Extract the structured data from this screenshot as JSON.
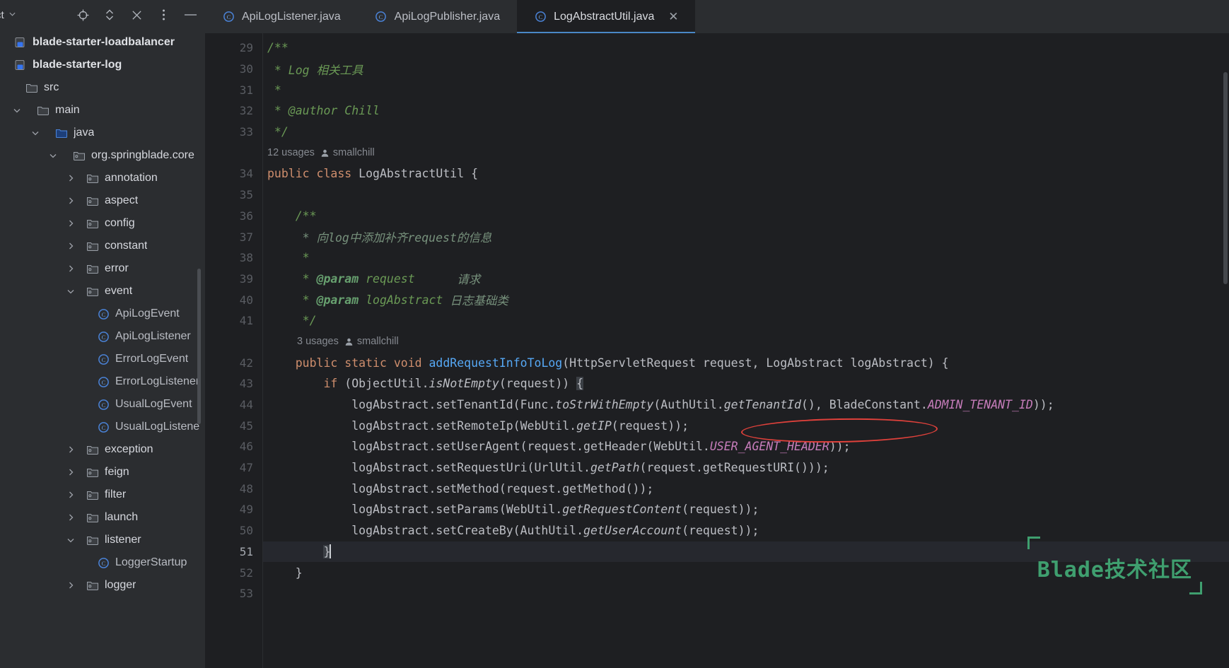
{
  "sidebar": {
    "title": "ct",
    "title_full": "Project",
    "chevron": "⌄",
    "tools": [
      {
        "name": "locate-icon",
        "label": "Select Opened File"
      },
      {
        "name": "expand-collapse-icon",
        "label": "Expand/Collapse"
      },
      {
        "name": "close-icon",
        "label": "Hide"
      },
      {
        "name": "more-options-icon",
        "label": "Options"
      },
      {
        "name": "minimize-icon",
        "label": "Minimize"
      }
    ],
    "tree": [
      {
        "label": "blade-starter-loadbalancer",
        "icon": "module-icon",
        "arrow": "none",
        "indent": 0,
        "bold": true
      },
      {
        "label": "blade-starter-log",
        "icon": "module-icon",
        "arrow": "none",
        "indent": 0,
        "bold": true
      },
      {
        "label": "src",
        "icon": "folder-icon",
        "arrow": "none",
        "indent": 1,
        "bold": false
      },
      {
        "label": "main",
        "icon": "folder-icon",
        "arrow": "down",
        "indent": 2,
        "bold": false
      },
      {
        "label": "java",
        "icon": "folder-source-icon",
        "arrow": "down",
        "indent": 3,
        "bold": false
      },
      {
        "label": "org.springblade.core",
        "icon": "package-icon",
        "arrow": "down",
        "indent": 4,
        "bold": false
      },
      {
        "label": "annotation",
        "icon": "package-icon",
        "arrow": "right",
        "indent": 5,
        "bold": false
      },
      {
        "label": "aspect",
        "icon": "package-icon",
        "arrow": "right",
        "indent": 5,
        "bold": false
      },
      {
        "label": "config",
        "icon": "package-icon",
        "arrow": "right",
        "indent": 5,
        "bold": false
      },
      {
        "label": "constant",
        "icon": "package-icon",
        "arrow": "right",
        "indent": 5,
        "bold": false
      },
      {
        "label": "error",
        "icon": "package-icon",
        "arrow": "right",
        "indent": 5,
        "bold": false
      },
      {
        "label": "event",
        "icon": "package-icon",
        "arrow": "down",
        "indent": 5,
        "bold": false
      },
      {
        "label": "ApiLogEvent",
        "icon": "java-class-icon",
        "arrow": "none",
        "indent": 6,
        "bold": false
      },
      {
        "label": "ApiLogListener",
        "icon": "java-class-icon",
        "arrow": "none",
        "indent": 6,
        "bold": false
      },
      {
        "label": "ErrorLogEvent",
        "icon": "java-class-icon",
        "arrow": "none",
        "indent": 6,
        "bold": false
      },
      {
        "label": "ErrorLogListener",
        "icon": "java-class-icon",
        "arrow": "none",
        "indent": 6,
        "bold": false
      },
      {
        "label": "UsualLogEvent",
        "icon": "java-class-icon",
        "arrow": "none",
        "indent": 6,
        "bold": false
      },
      {
        "label": "UsualLogListener",
        "icon": "java-class-icon",
        "arrow": "none",
        "indent": 6,
        "bold": false
      },
      {
        "label": "exception",
        "icon": "package-icon",
        "arrow": "right",
        "indent": 5,
        "bold": false
      },
      {
        "label": "feign",
        "icon": "package-icon",
        "arrow": "right",
        "indent": 5,
        "bold": false
      },
      {
        "label": "filter",
        "icon": "package-icon",
        "arrow": "right",
        "indent": 5,
        "bold": false
      },
      {
        "label": "launch",
        "icon": "package-icon",
        "arrow": "right",
        "indent": 5,
        "bold": false
      },
      {
        "label": "listener",
        "icon": "package-icon",
        "arrow": "down",
        "indent": 5,
        "bold": false
      },
      {
        "label": "LoggerStartup",
        "icon": "java-class-icon",
        "arrow": "none",
        "indent": 6,
        "bold": false
      },
      {
        "label": "logger",
        "icon": "package-icon",
        "arrow": "right",
        "indent": 5,
        "bold": false
      }
    ]
  },
  "tabs": [
    {
      "label": "ApiLogListener.java",
      "icon": "java-class-icon",
      "active": false,
      "closable": false
    },
    {
      "label": "ApiLogPublisher.java",
      "icon": "java-class-icon",
      "active": false,
      "closable": false
    },
    {
      "label": "LogAbstractUtil.java",
      "icon": "java-class-icon",
      "active": true,
      "closable": true,
      "close": "✕"
    }
  ],
  "editor": {
    "gutter": [
      "29",
      "30",
      "31",
      "32",
      "33",
      "",
      "34",
      "35",
      "36",
      "37",
      "38",
      "39",
      "40",
      "41",
      "",
      "42",
      "43",
      "44",
      "45",
      "46",
      "47",
      "48",
      "49",
      "50",
      "51",
      "52",
      "53"
    ],
    "current_line": "51",
    "hints": [
      {
        "after_gutter_index": 5,
        "usages": "12 usages",
        "author": "smallchill"
      },
      {
        "after_gutter_index": 14,
        "usages": "3 usages",
        "author": "smallchill"
      }
    ],
    "lines": [
      {
        "n": "29",
        "text": "/**"
      },
      {
        "n": "30",
        "text": " * Log 相关工具"
      },
      {
        "n": "31",
        "text": " *"
      },
      {
        "n": "32",
        "text": " * @author Chill"
      },
      {
        "n": "33",
        "text": " */"
      },
      {
        "n": "34",
        "text": "public class LogAbstractUtil {"
      },
      {
        "n": "35",
        "text": ""
      },
      {
        "n": "36",
        "text": "    /**"
      },
      {
        "n": "37",
        "text": "     * 向log中添加补齐request的信息"
      },
      {
        "n": "38",
        "text": "     *"
      },
      {
        "n": "39",
        "text": "     * @param request      请求"
      },
      {
        "n": "40",
        "text": "     * @param logAbstract 日志基础类"
      },
      {
        "n": "41",
        "text": "     */"
      },
      {
        "n": "42",
        "text": "    public static void addRequestInfoToLog(HttpServletRequest request, LogAbstract logAbstract) {"
      },
      {
        "n": "43",
        "text": "        if (ObjectUtil.isNotEmpty(request)) {"
      },
      {
        "n": "44",
        "text": "            logAbstract.setTenantId(Func.toStrWithEmpty(AuthUtil.getTenantId(), BladeConstant.ADMIN_TENANT_ID));"
      },
      {
        "n": "45",
        "text": "            logAbstract.setRemoteIp(WebUtil.getIP(request));"
      },
      {
        "n": "46",
        "text": "            logAbstract.setUserAgent(request.getHeader(WebUtil.USER_AGENT_HEADER));"
      },
      {
        "n": "47",
        "text": "            logAbstract.setRequestUri(UrlUtil.getPath(request.getRequestURI()));"
      },
      {
        "n": "48",
        "text": "            logAbstract.setMethod(request.getMethod());"
      },
      {
        "n": "49",
        "text": "            logAbstract.setParams(WebUtil.getRequestContent(request));"
      },
      {
        "n": "50",
        "text": "            logAbstract.setCreateBy(AuthUtil.getUserAccount(request));"
      },
      {
        "n": "51",
        "text": "        }"
      },
      {
        "n": "52",
        "text": "    }"
      },
      {
        "n": "53",
        "text": ""
      }
    ]
  },
  "annotation": {
    "name": "red-ellipse-highlight",
    "target_text": "WebUtil.getIP(request));",
    "color": "#e0413b"
  },
  "watermark": {
    "text": "Blade技术社区",
    "color": "#3f9f6f"
  }
}
